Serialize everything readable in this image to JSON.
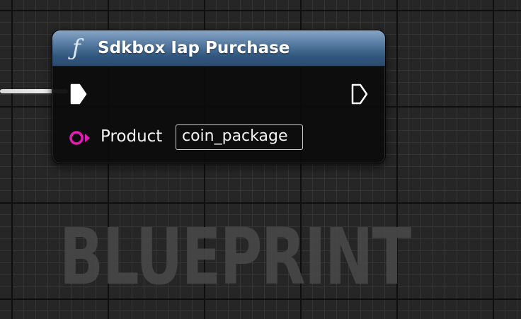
{
  "graph": {
    "watermark": "BLUEPRINT"
  },
  "node": {
    "icon": "function-icon",
    "icon_glyph": "ƒ",
    "title": "Sdkbox Iap Purchase",
    "header_color": "#30557c",
    "pins": {
      "exec_in": {
        "icon": "exec-input-pin-icon",
        "connected": true
      },
      "exec_out": {
        "icon": "exec-output-pin-icon",
        "connected": false
      },
      "product": {
        "label": "Product",
        "value": "coin_package",
        "icon": "string-pin-icon",
        "pin_color": "#e81ab8"
      }
    }
  },
  "colors": {
    "wire": "#e8e8e8",
    "background": "#262626",
    "string_pin": "#e81ab8"
  }
}
